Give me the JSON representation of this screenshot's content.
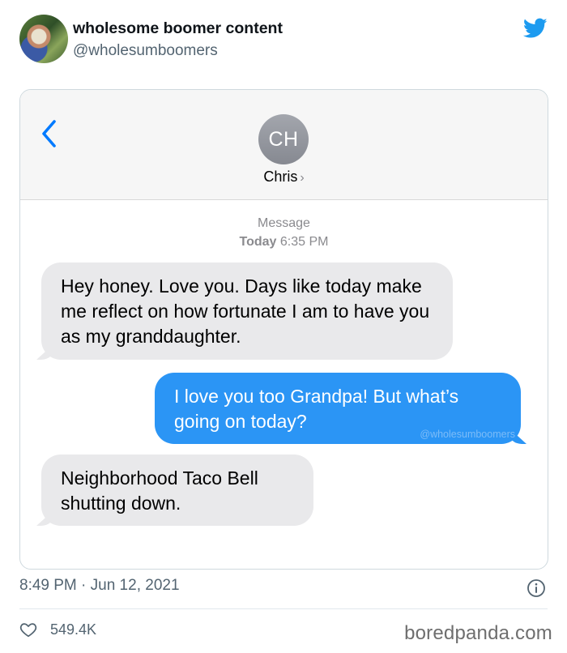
{
  "tweet": {
    "display_name": "wholesome boomer content",
    "handle": "@wholesumboomers",
    "timestamp": "8:49 PM · Jun 12, 2021",
    "like_count": "549.4K"
  },
  "imessage": {
    "contact_initials": "CH",
    "contact_name": "Chris",
    "contact_chevron": "›",
    "meta_label": "Message",
    "meta_day": "Today",
    "meta_time": "6:35 PM",
    "messages": [
      {
        "direction": "incoming",
        "text": "Hey honey. Love you. Days like today make me reflect on how fortunate I am to have you as my granddaughter."
      },
      {
        "direction": "outgoing",
        "text": "I love you too Grandpa! But what’s going on today?"
      },
      {
        "direction": "incoming",
        "text": "Neighborhood Taco Bell shutting down."
      }
    ],
    "watermark": "@wholesumboomers"
  },
  "source_mark": "boredpanda.com",
  "colors": {
    "twitter_blue": "#1d9bf0",
    "imessage_blue": "#2b95f5",
    "incoming_gray": "#e9e9eb",
    "ios_blue": "#007aff"
  },
  "icons": [
    "twitter-bird-icon",
    "back-chevron-icon",
    "info-icon",
    "heart-icon"
  ]
}
